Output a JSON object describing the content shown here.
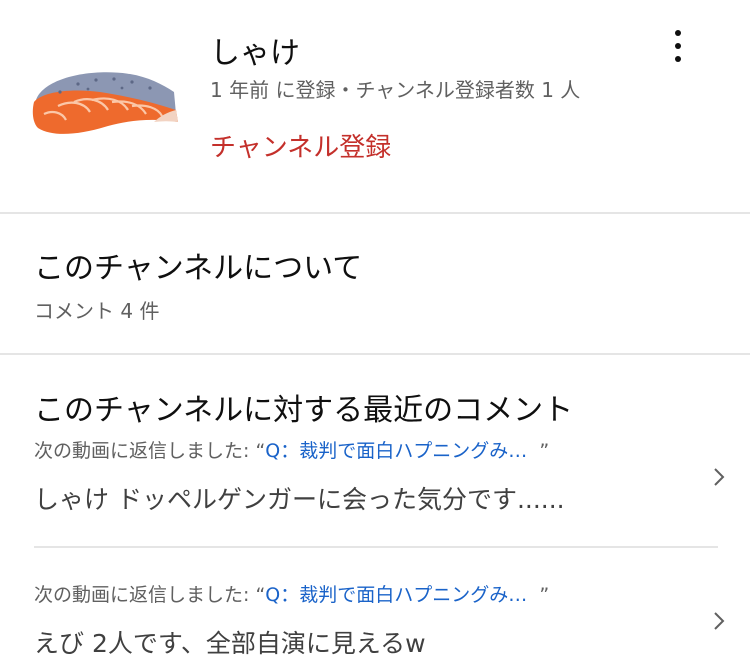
{
  "channel": {
    "name": "しゃけ",
    "meta": "1 年前 に登録・チャンネル登録者数 1 人",
    "subscribe_label": "チャンネル登録",
    "avatar_icon": "salmon-fillet-icon",
    "more_icon": "more-vert-icon"
  },
  "about": {
    "title": "このチャンネルについて",
    "subtitle": "コメント 4 件"
  },
  "recent": {
    "title": "このチャンネルに対する最近のコメント",
    "comments": [
      {
        "prefix": "次の動画に返信しました: “",
        "video_title": "Q：裁判で面白ハプニングみ…",
        "suffix": "”",
        "text": "しゃけ ドッペルゲンガーに会った気分です......"
      },
      {
        "prefix": "次の動画に返信しました: “",
        "video_title": "Q：裁判で面白ハプニングみ…",
        "suffix": "”",
        "text": "えび 2人です、全部自演に見えるw"
      }
    ]
  },
  "colors": {
    "subscribe": "#c4302b",
    "link": "#1a63c9",
    "secondary_text": "#606060",
    "divider": "#e5e5e5"
  }
}
